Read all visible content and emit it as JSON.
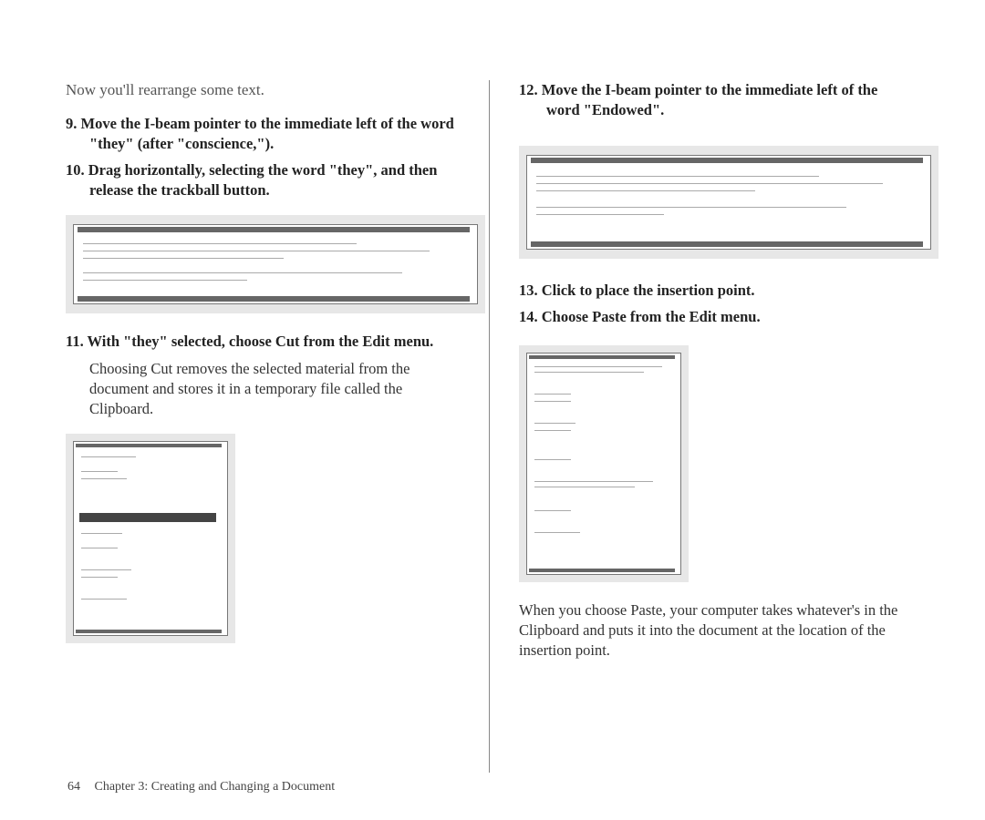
{
  "left": {
    "intro": "Now you'll rearrange some text.",
    "step9_num": "9.",
    "step9": " Move the I-beam pointer to the immediate left of the word \"they\" (after \"conscience,\").",
    "step10_num": "10.",
    "step10": " Drag horizontally, selecting the word \"they\", and then release the trackball button.",
    "step11_num": "11.",
    "step11": " With \"they\" selected, choose Cut from the Edit menu.",
    "step11_body": "Choosing Cut removes the selected material from the document and stores it in a temporary file called the Clipboard."
  },
  "right": {
    "step12_num": "12.",
    "step12": " Move the I-beam pointer to the immediate left of the word \"Endowed\".",
    "step13_num": "13.",
    "step13": " Click to place the insertion point.",
    "step14_num": "14.",
    "step14": " Choose Paste from the Edit menu.",
    "paste_body": "When you choose Paste, your computer takes whatever's in the Clipboard and puts it into the document at the location of the insertion point."
  },
  "footer": {
    "page": "64",
    "chapter": "Chapter 3: Creating and Changing a Document"
  }
}
